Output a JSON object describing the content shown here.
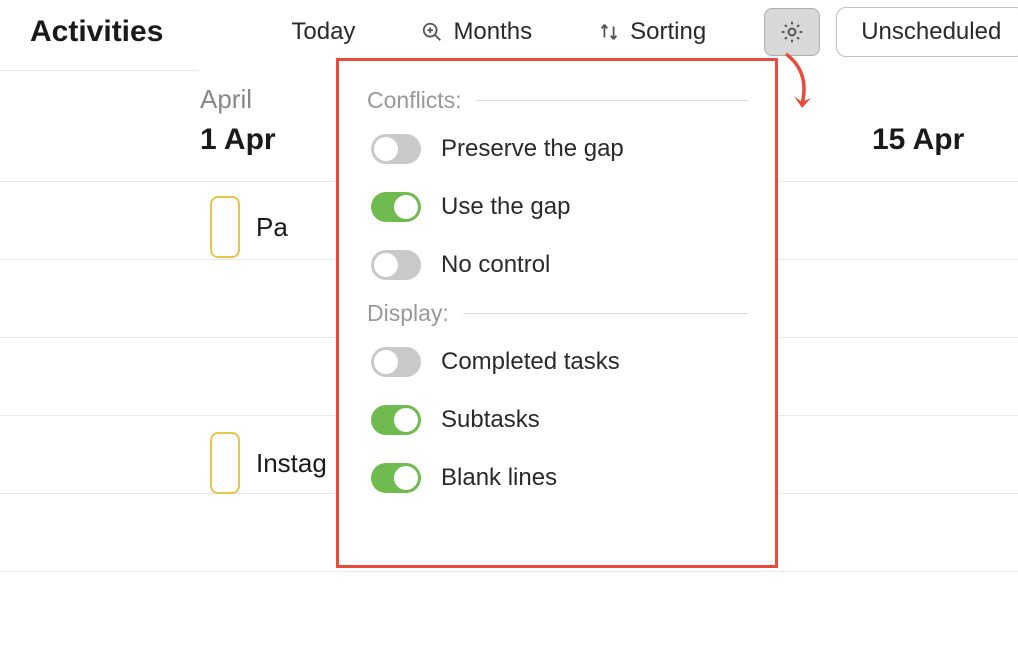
{
  "toolbar": {
    "title": "Activities",
    "today": "Today",
    "months": "Months",
    "sorting": "Sorting",
    "unscheduled": "Unscheduled"
  },
  "timeline": {
    "month": "April",
    "date_left": "1 Apr",
    "date_right": "15 Apr",
    "tasks": [
      {
        "label": "Pa"
      },
      {
        "label": "Instag"
      }
    ]
  },
  "dropdown": {
    "section_conflicts": "Conflicts:",
    "section_display": "Display:",
    "toggles": {
      "preserve_gap": {
        "label": "Preserve the gap",
        "on": false
      },
      "use_gap": {
        "label": "Use the gap",
        "on": true
      },
      "no_control": {
        "label": "No control",
        "on": false
      },
      "completed_tasks": {
        "label": "Completed tasks",
        "on": false
      },
      "subtasks": {
        "label": "Subtasks",
        "on": true
      },
      "blank_lines": {
        "label": "Blank lines",
        "on": true
      }
    }
  },
  "colors": {
    "accent_red": "#e74c3c",
    "toggle_on": "#6fbb4f",
    "chip_border": "#e8c54a"
  }
}
